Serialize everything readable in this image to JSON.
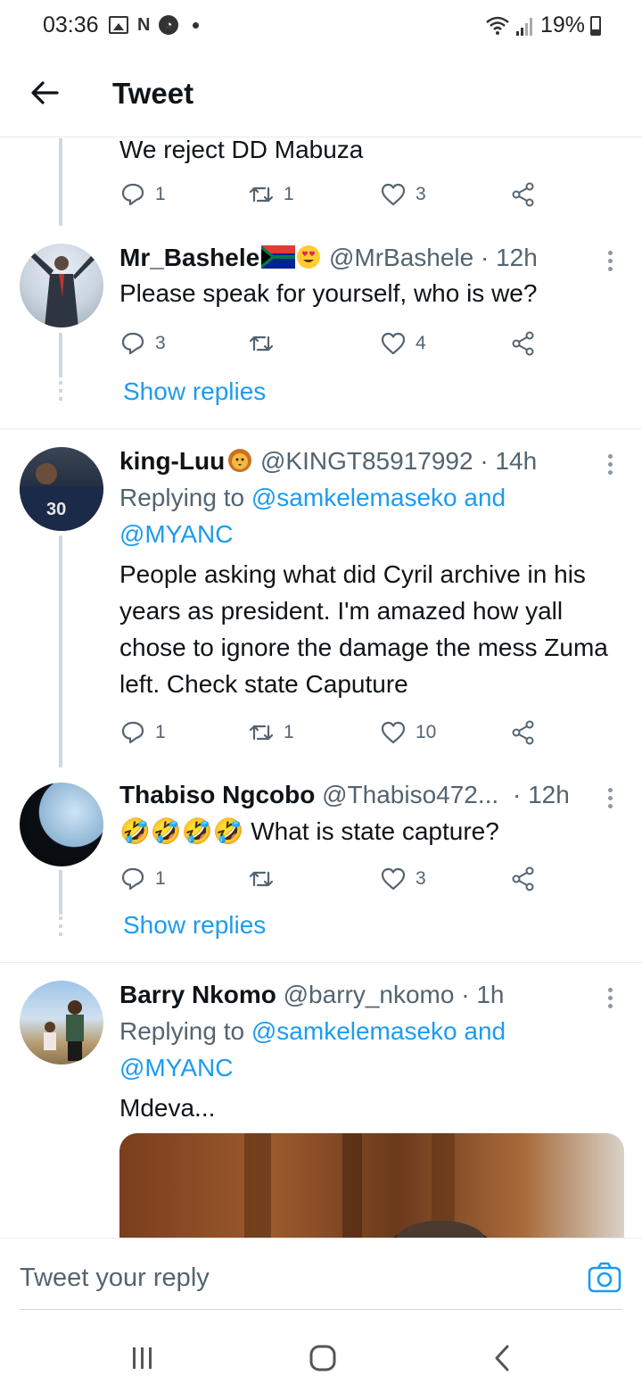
{
  "status_bar": {
    "time": "03:36",
    "battery": "19%"
  },
  "header": {
    "title": "Tweet"
  },
  "tweets": [
    {
      "text": "We reject DD Mabuza",
      "replies": "1",
      "retweets": "1",
      "likes": "3"
    },
    {
      "name": "Mr_Bashele",
      "handle_time": "@MrBashele · 12h",
      "text": "Please speak for yourself, who is we?",
      "replies": "3",
      "retweets": "",
      "likes": "4",
      "show_replies": "Show replies"
    },
    {
      "name": "king-Luu",
      "handle_time": "@KINGT85917992 · 14h",
      "replying_prefix": "Replying to ",
      "replying_mention_1": "@samkelemaseko and",
      "replying_mention_2": "@MYANC",
      "text": "People asking what did Cyril archive in his years as president. I'm amazed how yall chose to ignore the damage the mess Zuma left. Check state Caputure",
      "replies": "1",
      "retweets": "1",
      "likes": "10"
    },
    {
      "name": "Thabiso Ngcobo",
      "handle": "@Thabiso472...",
      "time": "· 12h",
      "text": "What is state capture?",
      "emojis": "🤣🤣🤣🤣",
      "replies": "1",
      "retweets": "",
      "likes": "3",
      "show_replies": "Show replies"
    },
    {
      "name": "Barry Nkomo",
      "handle_time": "@barry_nkomo · 1h",
      "replying_prefix": "Replying to ",
      "replying_mention_1": "@samkelemaseko and",
      "replying_mention_2": "@MYANC",
      "text": "Mdeva..."
    }
  ],
  "reply_bar": {
    "placeholder": "Tweet your reply"
  },
  "icons": [
    "back-arrow-icon",
    "reply-icon",
    "retweet-icon",
    "like-icon",
    "share-icon",
    "more-icon",
    "camera-icon"
  ],
  "colors": {
    "accent": "#1d9bf0",
    "secondary_text": "#536471",
    "text": "#0f1419"
  }
}
